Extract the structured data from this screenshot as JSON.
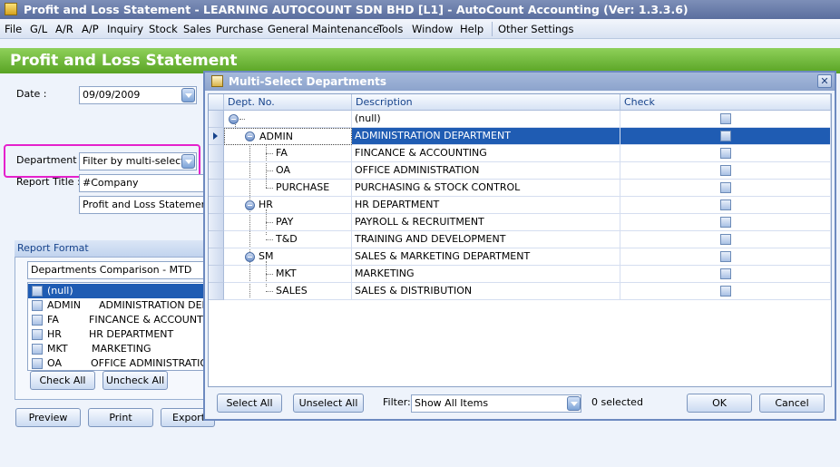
{
  "window": {
    "title": "Profit and Loss Statement - LEARNING AUTOCOUNT SDN BHD [L1] - AutoCount Accounting (Ver: 1.3.3.6)"
  },
  "menu": [
    "File",
    "G/L",
    "A/R",
    "A/P",
    "Inquiry",
    "Stock",
    "Sales",
    "Purchase",
    "General Maintenance",
    "Tools",
    "Window",
    "Help",
    "Other Settings"
  ],
  "page": {
    "title": "Profit and Loss Statement"
  },
  "form": {
    "date_label": "Date :",
    "date_value": "09/09/2009",
    "department_label": "Department :",
    "department_value": "Filter by multi-select",
    "report_title_label": "Report Title :",
    "report_title_value": "#Company",
    "report_subtitle_value": "Profit and Loss Statement F"
  },
  "report_format": {
    "header": "Report Format",
    "format_value": "Departments Comparison - MTD",
    "items": [
      {
        "code": "(null)",
        "desc": ""
      },
      {
        "code": "ADMIN",
        "desc": "ADMINISTRATION DEPA"
      },
      {
        "code": "FA",
        "desc": "FINCANCE & ACCOUNTING"
      },
      {
        "code": "HR",
        "desc": "HR DEPARTMENT"
      },
      {
        "code": "MKT",
        "desc": "MARKETING"
      },
      {
        "code": "OA",
        "desc": "OFFICE ADMINISTRATION"
      }
    ],
    "check_all": "Check All",
    "uncheck_all": "Uncheck All"
  },
  "actions": {
    "preview": "Preview",
    "print": "Print",
    "export": "Export"
  },
  "dialog": {
    "title": "Multi-Select Departments",
    "columns": {
      "dept_no": "Dept. No.",
      "description": "Description",
      "check": "Check"
    },
    "rows": [
      {
        "code": "",
        "desc": "(null)"
      },
      {
        "code": "ADMIN",
        "desc": "ADMINISTRATION DEPARTMENT"
      },
      {
        "code": "FA",
        "desc": "FINCANCE & ACCOUNTING"
      },
      {
        "code": "OA",
        "desc": "OFFICE ADMINISTRATION"
      },
      {
        "code": "PURCHASE",
        "desc": "PURCHASING & STOCK CONTROL"
      },
      {
        "code": "HR",
        "desc": "HR DEPARTMENT"
      },
      {
        "code": "PAY",
        "desc": "PAYROLL & RECRUITMENT"
      },
      {
        "code": "T&D",
        "desc": "TRAINING AND DEVELOPMENT"
      },
      {
        "code": "SM",
        "desc": "SALES & MARKETING DEPARTMENT"
      },
      {
        "code": "MKT",
        "desc": "MARKETING"
      },
      {
        "code": "SALES",
        "desc": "SALES & DISTRIBUTION"
      }
    ],
    "select_all": "Select All",
    "unselect_all": "Unselect All",
    "filter_label": "Filter:",
    "filter_value": "Show All Items",
    "selected_count": "0 selected",
    "ok": "OK",
    "cancel": "Cancel"
  },
  "colors": {
    "banner": "#58a323",
    "selection": "#1f5cb3",
    "highlight": "#e521cc"
  }
}
